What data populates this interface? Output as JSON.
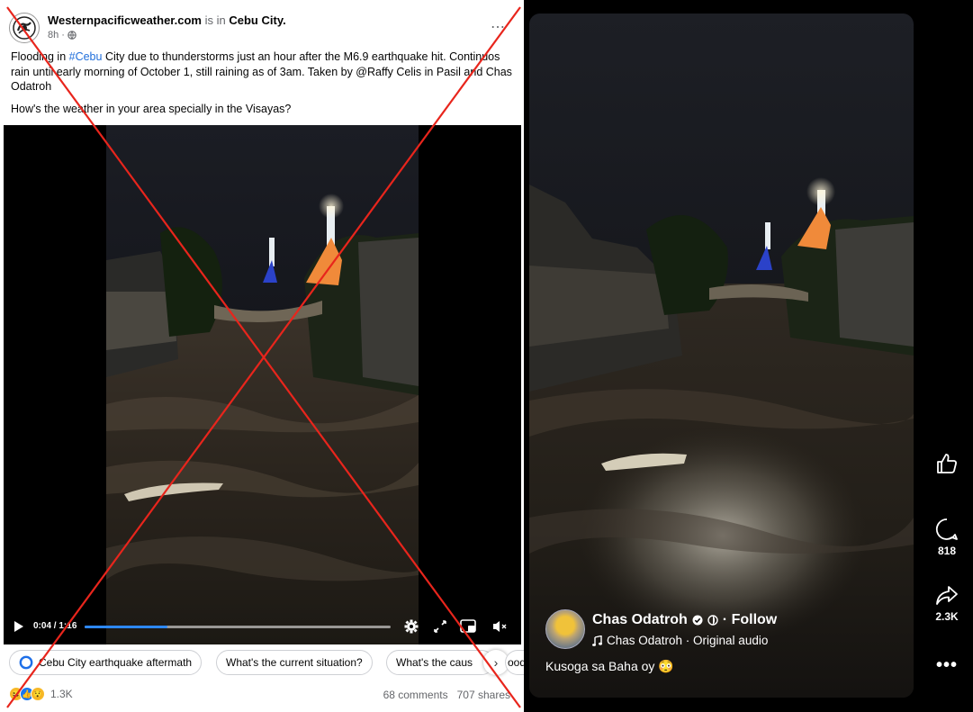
{
  "post": {
    "page_name": "Westernpacificweather.com",
    "is_in": "is in",
    "location": "Cebu City.",
    "time": "8h",
    "text_1": "Flooding in ",
    "hashtag": "#Cebu",
    "text_2": " City due to thunderstorms just an hour after the M6.9 earthquake hit. Continuos rain until early morning of October 1, still raining as of 3am. Taken by @Raffy Celis in Pasil and Chas Odatroh",
    "question": "How's the weather in your area specially in the Visayas?"
  },
  "video": {
    "current_time": "0:04",
    "separator": " / ",
    "duration": "1:16",
    "progress": 0.27
  },
  "chips": [
    {
      "label": "Cebu City earthquake aftermath"
    },
    {
      "label": "What's the current situation?"
    },
    {
      "label": "What's the caus"
    },
    {
      "label": "ood"
    }
  ],
  "stats": {
    "reactions_count": "1.3K",
    "comments": "68 comments",
    "shares": "707 shares"
  },
  "reel": {
    "author": "Chas Odatroh",
    "follow": "· Follow",
    "audio": "Chas Odatroh · Original audio",
    "caption": "Kusoga sa Baha oy",
    "comments_count": "818",
    "shares_count": "2.3K"
  },
  "colors": {
    "cross": "#e8251c",
    "link": "#216fdb",
    "progress": "#2d88ff"
  }
}
